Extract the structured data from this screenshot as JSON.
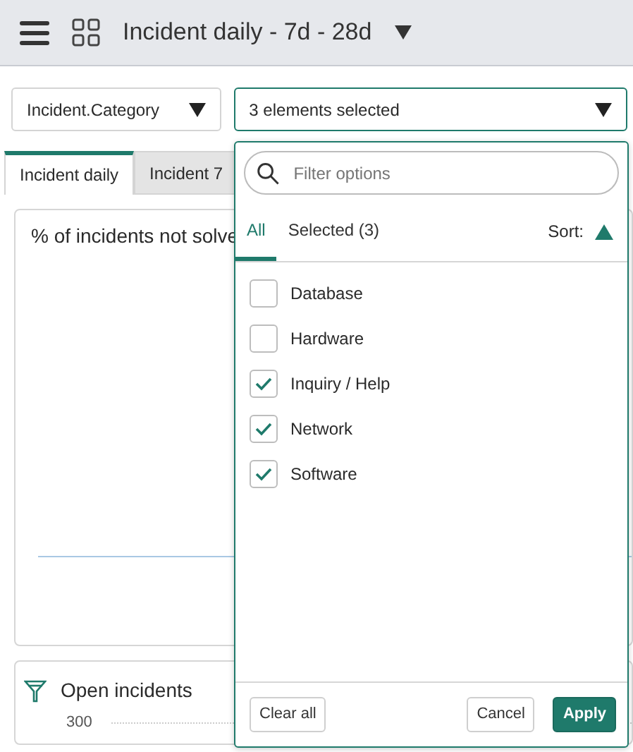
{
  "header": {
    "title": "Incident daily - 7d - 28d"
  },
  "filters": [
    {
      "value": "Incident.Category"
    },
    {
      "value": "3 elements selected"
    }
  ],
  "tabs": [
    {
      "label": "Incident daily",
      "selected": true
    },
    {
      "label": "Incident 7",
      "selected": false
    }
  ],
  "cards": [
    {
      "title": "% of incidents not solve"
    },
    {
      "title": "Open incidents",
      "tick": "300"
    }
  ],
  "dropdown": {
    "search": {
      "placeholder": "Filter options"
    },
    "tabs": [
      {
        "label": "All",
        "selected": true
      },
      {
        "label": "Selected (3)",
        "selected": false
      }
    ],
    "sort": {
      "label": "Sort:"
    },
    "options": [
      {
        "label": "Database",
        "checked": false
      },
      {
        "label": "Hardware",
        "checked": false
      },
      {
        "label": "Inquiry / Help",
        "checked": true
      },
      {
        "label": "Network",
        "checked": true
      },
      {
        "label": "Software",
        "checked": true
      }
    ],
    "buttons": [
      {
        "label": "Clear all",
        "kind": "secondary"
      },
      {
        "label": "Cancel",
        "kind": "secondary"
      },
      {
        "label": "Apply",
        "kind": "primary"
      }
    ]
  }
}
